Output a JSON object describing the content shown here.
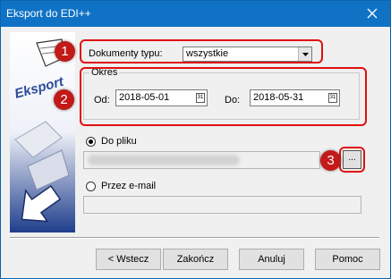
{
  "window": {
    "title": "Eksport do EDI++"
  },
  "sidebar": {
    "image_text": "Eksport"
  },
  "filter": {
    "label": "Dokumenty typu:",
    "value": "wszystkie"
  },
  "period": {
    "group_label": "Okres",
    "from_label": "Od:",
    "from_value": "2018-05-01",
    "to_label": "Do:",
    "to_value": "2018-05-31",
    "calendar_glyph": "31"
  },
  "destination": {
    "file_label": "Do pliku",
    "file_selected": true,
    "browse_label": "...",
    "email_label": "Przez e-mail"
  },
  "annotations": {
    "badge1": "1",
    "badge2": "2",
    "badge3": "3"
  },
  "buttons": {
    "back": "< Wstecz",
    "finish": "Zakończ",
    "cancel": "Anuluj",
    "help": "Pomoc"
  },
  "colors": {
    "titlebar": "#1072c4",
    "highlight": "#e01010",
    "badge": "#c21919"
  }
}
